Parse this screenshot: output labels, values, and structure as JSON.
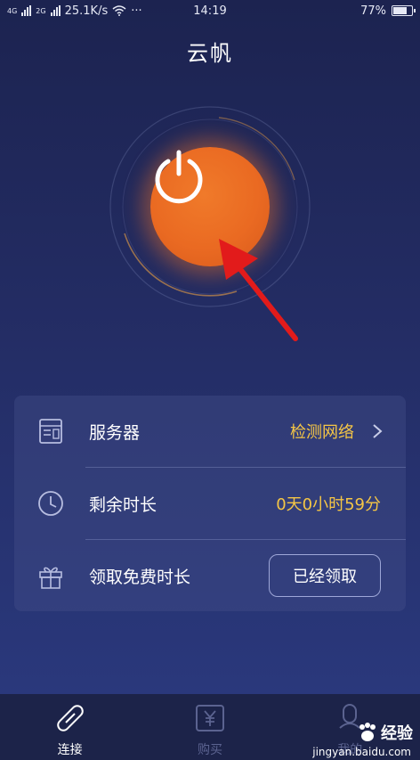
{
  "status_bar": {
    "network": "4G",
    "network2": "2G",
    "speed": "25.1K/s",
    "dots": "···",
    "time": "14:19",
    "battery": "77%",
    "battery_level": 0.77
  },
  "app": {
    "title": "云帆"
  },
  "connect": {
    "state_icon": "power-icon"
  },
  "info_card": {
    "server": {
      "label": "服务器",
      "value": "检测网络",
      "icon": "server-icon"
    },
    "remaining": {
      "label": "剩余时长",
      "value": "0天0小时59分",
      "icon": "clock-icon"
    },
    "free": {
      "label": "领取免费时长",
      "button": "已经领取",
      "icon": "gift-icon"
    }
  },
  "bottom_nav": {
    "items": [
      {
        "label": "连接",
        "icon": "link-icon",
        "active": true
      },
      {
        "label": "购买",
        "icon": "purchase-icon",
        "active": false
      },
      {
        "label": "我的",
        "icon": "profile-icon",
        "active": false
      }
    ]
  },
  "watermark": {
    "text": "经验",
    "url": "jingyan.baidu.com"
  },
  "colors": {
    "accent": "#f5c645",
    "power": "#ea6a22",
    "background": "#232c63"
  }
}
